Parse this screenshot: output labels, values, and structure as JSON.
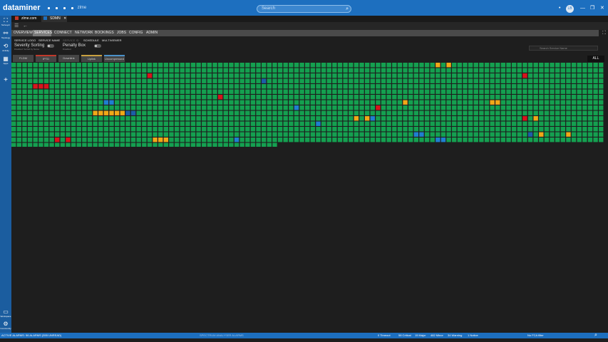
{
  "titlebar": {
    "app_name": "dataminer",
    "host": "zlme",
    "search_placeholder": "Search",
    "avatar_initials": "LB",
    "minimize": "—",
    "maximize": "❐",
    "close": "✕"
  },
  "sidebar": {
    "items": [
      {
        "label": "Surveyor",
        "icon": "surveyor-icon",
        "glyph": "⛶"
      },
      {
        "label": "Topology",
        "icon": "topology-icon",
        "glyph": "⚯"
      },
      {
        "label": "Activity",
        "icon": "activity-icon",
        "glyph": "⟲"
      },
      {
        "label": "Apps",
        "icon": "apps-icon",
        "glyph": "▦"
      },
      {
        "label": "",
        "icon": "add-icon",
        "glyph": "+"
      },
      {
        "label": "Workspace",
        "icon": "workspace-icon",
        "glyph": "▭"
      },
      {
        "label": "Community",
        "icon": "settings-icon",
        "glyph": "⚙"
      }
    ]
  },
  "cards": [
    {
      "label": "zlme.com",
      "color": "#c0392b",
      "active": false
    },
    {
      "label": "SDMN",
      "color": "#1d6fbf",
      "active": true,
      "close": "✕"
    }
  ],
  "toolbar": {
    "menu_glyph": "☰",
    "back_glyph": "←"
  },
  "menu": {
    "items": [
      "OVERVIEW",
      "SERVICES",
      "CONNECT",
      "NETWORK",
      "BOOKINGS",
      "JOBS",
      "CONFIG",
      "ADMIN"
    ],
    "active": "SERVICES",
    "expand_glyph": "⛶"
  },
  "submenu": {
    "items": [
      "SERVICE LOGO",
      "SERVICE NAME",
      "SERVICE ID",
      "SCHEDULE",
      "MULTIVIEWER"
    ],
    "severity_title": "Severity Sorting",
    "severity_sub": "Disabled: Sorted by Name",
    "penalty_title": "Penalty Box",
    "penalty_sub": "Disabled",
    "search_placeholder": "Search Service Name"
  },
  "filter_tabs": [
    {
      "label": "FLDM",
      "accent": ""
    },
    {
      "label": "IPTD",
      "accent": "#c0392b"
    },
    {
      "label": "Downlink",
      "accent": ""
    },
    {
      "label": "Uplink",
      "accent": "#c8a040"
    },
    {
      "label": "Uncompressed",
      "accent": "#4a90c9"
    }
  ],
  "all_button": "ALL",
  "grid": {
    "columns": 109,
    "full_rows": 15,
    "last_row_count": 49,
    "colors": {
      "normal": "#14a050",
      "critical": "#d8141c",
      "major": "#f0a818",
      "masked": "#1f7fd0",
      "timeout": "#1c5ea8"
    },
    "special_cells": [
      {
        "row": 0,
        "col": 78,
        "state": "major"
      },
      {
        "row": 0,
        "col": 80,
        "state": "major"
      },
      {
        "row": 2,
        "col": 25,
        "state": "critical"
      },
      {
        "row": 2,
        "col": 94,
        "state": "critical"
      },
      {
        "row": 3,
        "col": 46,
        "state": "timeout"
      },
      {
        "row": 4,
        "col": 4,
        "state": "critical"
      },
      {
        "row": 4,
        "col": 5,
        "state": "critical"
      },
      {
        "row": 4,
        "col": 6,
        "state": "critical"
      },
      {
        "row": 6,
        "col": 38,
        "state": "critical"
      },
      {
        "row": 7,
        "col": 17,
        "state": "masked"
      },
      {
        "row": 7,
        "col": 18,
        "state": "masked"
      },
      {
        "row": 7,
        "col": 72,
        "state": "major"
      },
      {
        "row": 7,
        "col": 88,
        "state": "major"
      },
      {
        "row": 7,
        "col": 89,
        "state": "major"
      },
      {
        "row": 8,
        "col": 52,
        "state": "masked"
      },
      {
        "row": 8,
        "col": 67,
        "state": "critical"
      },
      {
        "row": 9,
        "col": 15,
        "state": "major"
      },
      {
        "row": 9,
        "col": 16,
        "state": "major"
      },
      {
        "row": 9,
        "col": 17,
        "state": "major"
      },
      {
        "row": 9,
        "col": 18,
        "state": "major"
      },
      {
        "row": 9,
        "col": 19,
        "state": "major"
      },
      {
        "row": 9,
        "col": 20,
        "state": "major"
      },
      {
        "row": 9,
        "col": 21,
        "state": "timeout"
      },
      {
        "row": 9,
        "col": 22,
        "state": "timeout"
      },
      {
        "row": 10,
        "col": 63,
        "state": "major"
      },
      {
        "row": 10,
        "col": 65,
        "state": "major"
      },
      {
        "row": 10,
        "col": 66,
        "state": "masked"
      },
      {
        "row": 10,
        "col": 94,
        "state": "critical"
      },
      {
        "row": 10,
        "col": 96,
        "state": "major"
      },
      {
        "row": 11,
        "col": 56,
        "state": "masked"
      },
      {
        "row": 13,
        "col": 74,
        "state": "masked"
      },
      {
        "row": 13,
        "col": 75,
        "state": "masked"
      },
      {
        "row": 13,
        "col": 95,
        "state": "timeout"
      },
      {
        "row": 13,
        "col": 97,
        "state": "major"
      },
      {
        "row": 13,
        "col": 102,
        "state": "major"
      },
      {
        "row": 14,
        "col": 8,
        "state": "critical"
      },
      {
        "row": 14,
        "col": 10,
        "state": "critical"
      },
      {
        "row": 14,
        "col": 26,
        "state": "major"
      },
      {
        "row": 14,
        "col": 27,
        "state": "major"
      },
      {
        "row": 14,
        "col": 28,
        "state": "major"
      },
      {
        "row": 14,
        "col": 41,
        "state": "masked"
      },
      {
        "row": 14,
        "col": 78,
        "state": "masked"
      },
      {
        "row": 14,
        "col": 79,
        "state": "masked"
      }
    ]
  },
  "statusbar": {
    "left": "ACTIVE ALARMS: 56 ALARMS (555 UNREAD)",
    "center": "SPECTRUM ANALYSER ALARMS",
    "counts": [
      "0 Timeout",
      "58 Critical",
      "15 Major",
      "482 Minor",
      "34 Warning",
      "1 Notice"
    ],
    "filter": "No FCA filter"
  }
}
